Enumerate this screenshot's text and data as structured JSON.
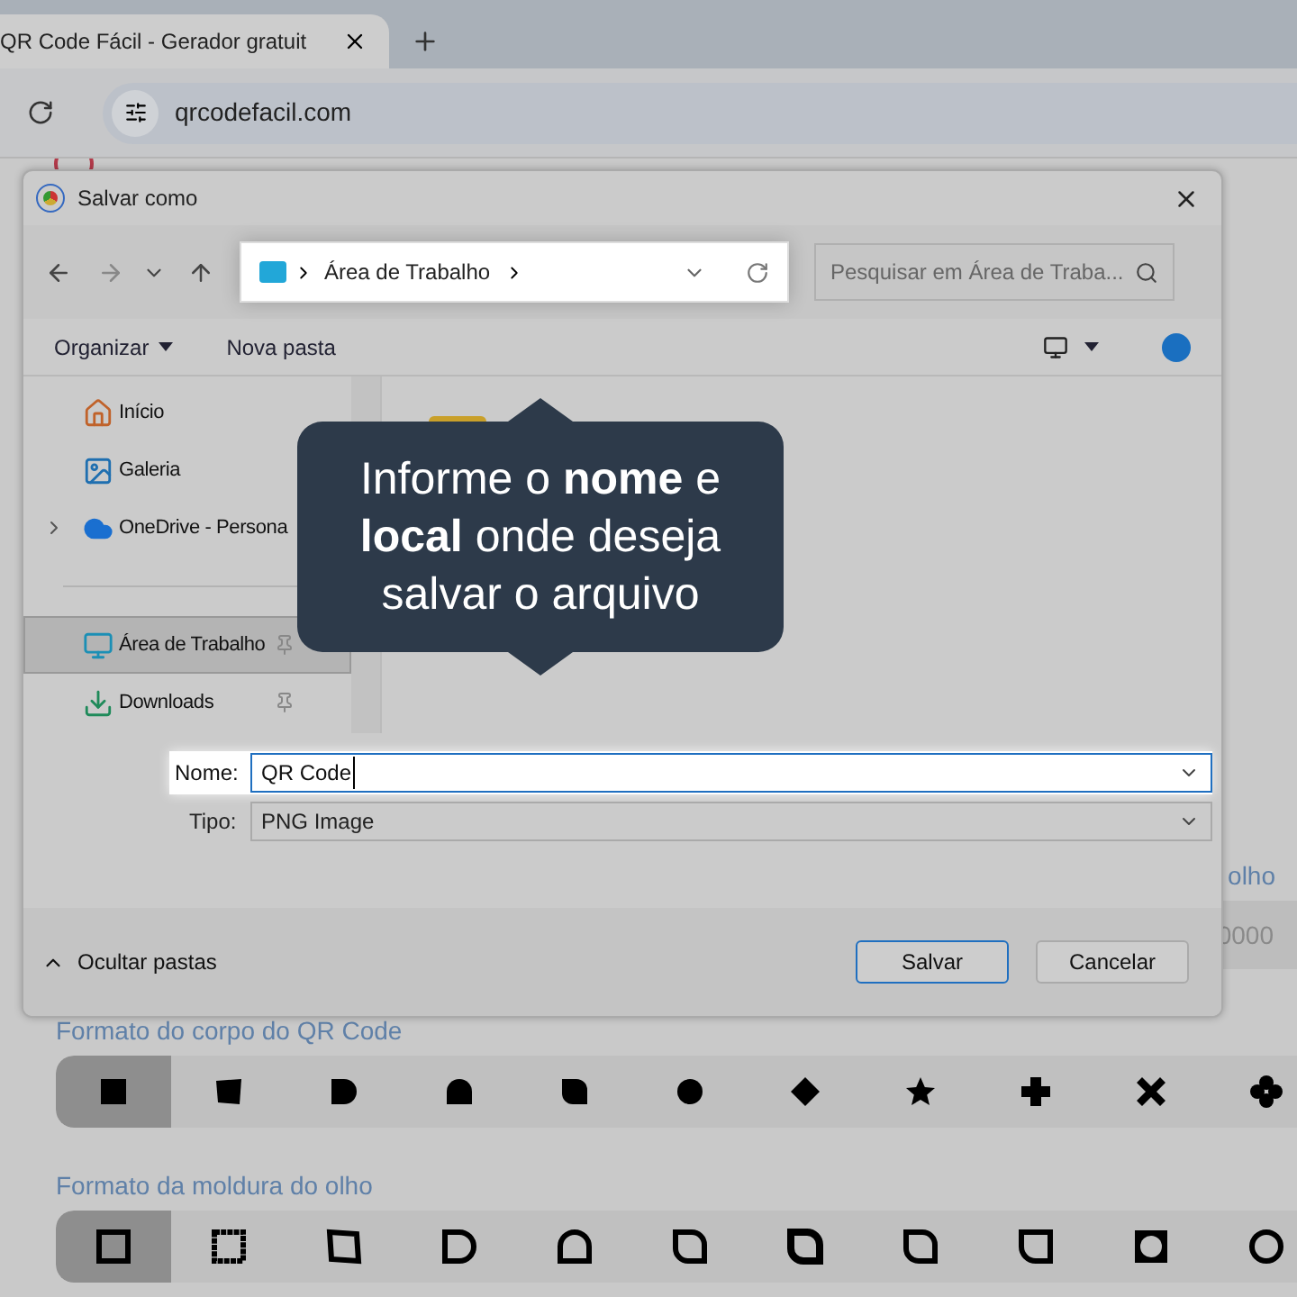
{
  "browser": {
    "tab": {
      "title": "QR Code Fácil - Gerador gratuit"
    },
    "url": "qrcodefacil.com"
  },
  "page": {
    "eye_label_tail": "olho",
    "color_field_tail": "0000",
    "sections": [
      {
        "title": "Formato do corpo do QR Code",
        "options": [
          {
            "kind": "square",
            "selected": true
          },
          {
            "kind": "tilted",
            "selected": false
          },
          {
            "kind": "half-round",
            "selected": false
          },
          {
            "kind": "drop",
            "selected": false
          },
          {
            "kind": "leaf",
            "selected": false
          },
          {
            "kind": "circle",
            "selected": false
          },
          {
            "kind": "diamond",
            "selected": false
          },
          {
            "kind": "star",
            "selected": false
          },
          {
            "kind": "plus",
            "selected": false
          },
          {
            "kind": "cross",
            "selected": false
          },
          {
            "kind": "flower",
            "selected": false
          }
        ]
      },
      {
        "title": "Formato da moldura do olho",
        "options": [
          {
            "kind": "frame-square",
            "selected": true
          },
          {
            "kind": "frame-rough",
            "selected": false
          },
          {
            "kind": "frame-tilted",
            "selected": false
          },
          {
            "kind": "frame-half-round",
            "selected": false
          },
          {
            "kind": "frame-drop",
            "selected": false
          },
          {
            "kind": "frame-leaf",
            "selected": false
          },
          {
            "kind": "frame-thick-leaf",
            "selected": false
          },
          {
            "kind": "frame-leaf",
            "selected": false
          },
          {
            "kind": "frame-drop-flip",
            "selected": false
          },
          {
            "kind": "frame-square-circle",
            "selected": false
          },
          {
            "kind": "frame-circle",
            "selected": false
          }
        ]
      }
    ]
  },
  "dialog": {
    "title": "Salvar como",
    "path": "Área de Trabalho",
    "search": {
      "placeholder": "Pesquisar em Área de Traba..."
    },
    "toolbar": {
      "organize": "Organizar",
      "new_folder": "Nova pasta"
    },
    "sidebar": [
      {
        "kind": "home",
        "label": "Início",
        "selected": false,
        "pinned": false,
        "expandable": false
      },
      {
        "kind": "gallery",
        "label": "Galeria",
        "selected": false,
        "pinned": false,
        "expandable": false
      },
      {
        "kind": "cloud",
        "label": "OneDrive - Persona",
        "selected": false,
        "pinned": false,
        "expandable": true
      },
      {
        "kind": "desktop",
        "label": "Área de Trabalho",
        "selected": true,
        "pinned": true,
        "expandable": false
      },
      {
        "kind": "download",
        "label": "Downloads",
        "selected": false,
        "pinned": true,
        "expandable": false
      }
    ],
    "name": {
      "label": "Nome:",
      "value": "QR Code"
    },
    "type": {
      "label": "Tipo:",
      "value": "PNG Image"
    },
    "hide_folders": "Ocultar pastas",
    "save": "Salvar",
    "cancel": "Cancelar"
  },
  "callout": {
    "text": "Informe o **nome** e **local** onde deseja salvar o arquivo"
  }
}
